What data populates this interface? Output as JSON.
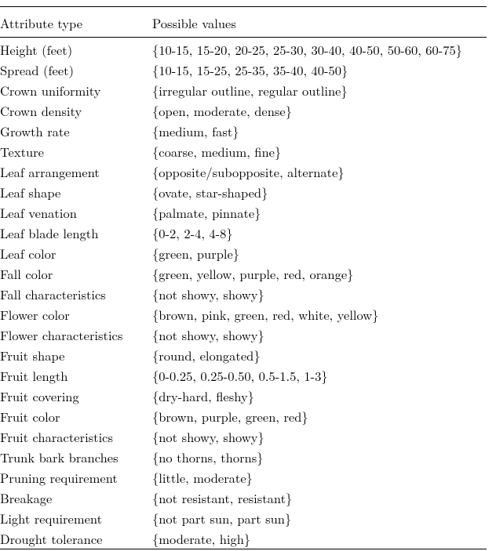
{
  "headers": {
    "attr": "Attribute type",
    "val": "Possible values"
  },
  "rows": [
    {
      "attr": "Height (feet)",
      "val": "{10-15, 15-20, 20-25, 25-30, 30-40, 40-50, 50-60, 60-75}"
    },
    {
      "attr": "Spread (feet)",
      "val": "{10-15, 15-25, 25-35, 35-40, 40-50}"
    },
    {
      "attr": "Crown uniformity",
      "val": "{irregular outline, regular outline}"
    },
    {
      "attr": "Crown density",
      "val": "{open, moderate, dense}"
    },
    {
      "attr": "Growth rate",
      "val": "{medium, fast}"
    },
    {
      "attr": "Texture",
      "val": "{coarse, medium, fine}"
    },
    {
      "attr": "Leaf arrangement",
      "val": "{opposite/subopposite, alternate}"
    },
    {
      "attr": "Leaf shape",
      "val": "{ovate, star-shaped}"
    },
    {
      "attr": "Leaf venation",
      "val": "{palmate, pinnate}"
    },
    {
      "attr": "Leaf blade length",
      "val": "{0-2, 2-4, 4-8}"
    },
    {
      "attr": "Leaf color",
      "val": "{green, purple}"
    },
    {
      "attr": "Fall color",
      "val": "{green, yellow, purple, red, orange}"
    },
    {
      "attr": "Fall characteristics",
      "val": "{not showy, showy}"
    },
    {
      "attr": "Flower color",
      "val": "{brown, pink, green, red, white, yellow}"
    },
    {
      "attr": "Flower characteristics",
      "val": "{not showy, showy}"
    },
    {
      "attr": "Fruit shape",
      "val": "{round, elongated}"
    },
    {
      "attr": "Fruit length",
      "val": "{0-0.25, 0.25-0.50, 0.5-1.5, 1-3}"
    },
    {
      "attr": "Fruit covering",
      "val": "{dry-hard, fleshy}"
    },
    {
      "attr": "Fruit color",
      "val": "{brown, purple, green, red}"
    },
    {
      "attr": "Fruit characteristics",
      "val": "{not showy, showy}"
    },
    {
      "attr": "Trunk bark branches",
      "val": "{no thorns, thorns}"
    },
    {
      "attr": "Pruning requirement",
      "val": "{little, moderate}"
    },
    {
      "attr": "Breakage",
      "val": "{not resistant, resistant}"
    },
    {
      "attr": "Light requirement",
      "val": "{not part sun, part sun}"
    },
    {
      "attr": "Drought tolerance",
      "val": "{moderate, high}"
    }
  ]
}
